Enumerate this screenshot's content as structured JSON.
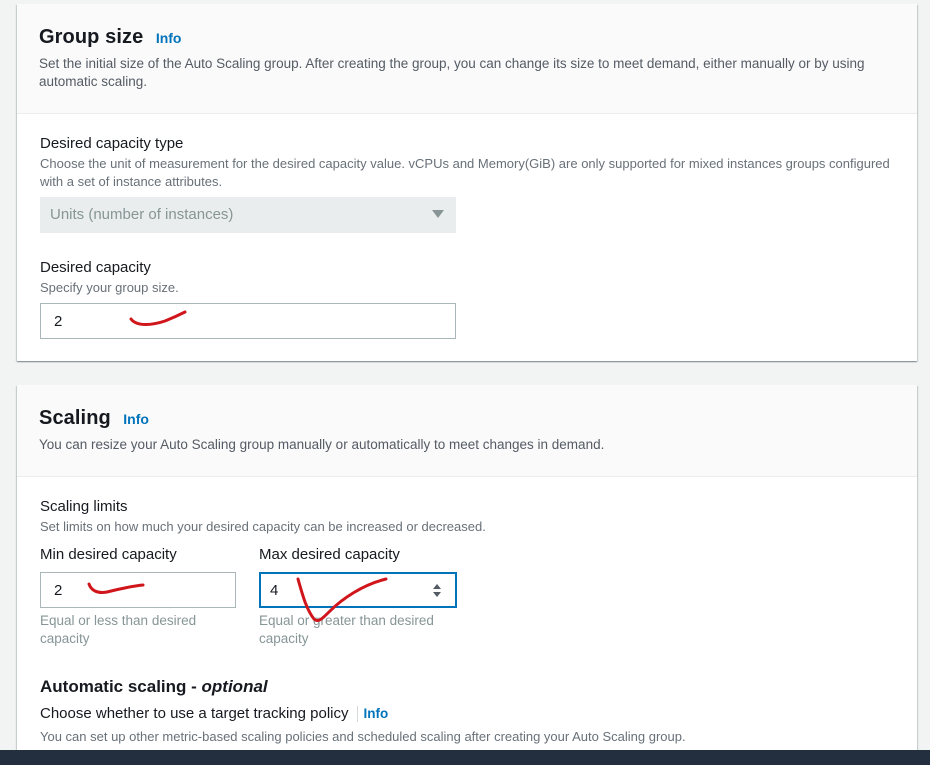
{
  "group_size": {
    "title": "Group size",
    "info": "Info",
    "description": "Set the initial size of the Auto Scaling group. After creating the group, you can change its size to meet demand, either manually or by using automatic scaling.",
    "capacity_type": {
      "label": "Desired capacity type",
      "description": "Choose the unit of measurement for the desired capacity value. vCPUs and Memory(GiB) are only supported for mixed instances groups configured with a set of instance attributes.",
      "selected": "Units (number of instances)"
    },
    "desired_capacity": {
      "label": "Desired capacity",
      "description": "Specify your group size.",
      "value": "2"
    }
  },
  "scaling": {
    "title": "Scaling",
    "info": "Info",
    "description": "You can resize your Auto Scaling group manually or automatically to meet changes in demand.",
    "limits": {
      "label": "Scaling limits",
      "description": "Set limits on how much your desired capacity can be increased or decreased."
    },
    "min": {
      "label": "Min desired capacity",
      "value": "2",
      "help": "Equal or less than desired capacity"
    },
    "max": {
      "label": "Max desired capacity",
      "value": "4",
      "help": "Equal or greater than desired capacity"
    },
    "automatic": {
      "title": "Automatic scaling - ",
      "optional": "optional",
      "question": "Choose whether to use a target tracking policy",
      "info": "Info",
      "description": "You can set up other metric-based scaling policies and scheduled scaling after creating your Auto Scaling group."
    }
  },
  "colors": {
    "link": "#0073bb",
    "annotation": "#d0161b",
    "focus": "#0073bb",
    "footer": "#232f3e"
  }
}
